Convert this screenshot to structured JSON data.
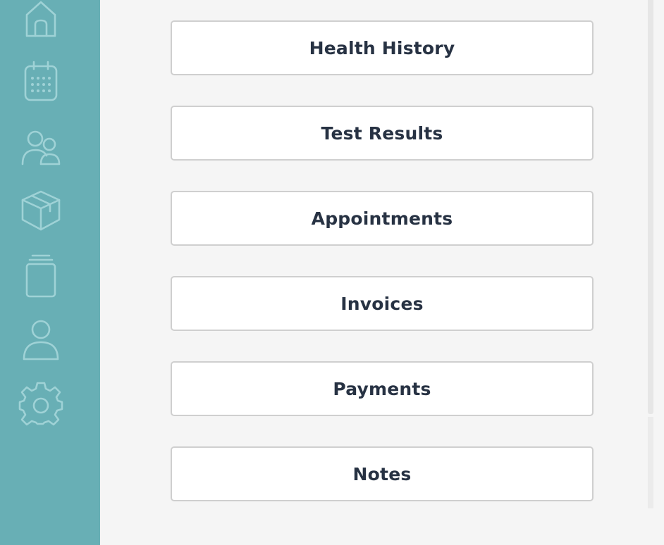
{
  "sidebar": {
    "items": [
      {
        "icon": "home-icon"
      },
      {
        "icon": "calendar-icon"
      },
      {
        "icon": "users-icon"
      },
      {
        "icon": "box-icon"
      },
      {
        "icon": "archive-icon"
      },
      {
        "icon": "user-icon"
      },
      {
        "icon": "gear-icon"
      }
    ]
  },
  "menu": {
    "health_history": "Health History",
    "test_results": "Test Results",
    "appointments": "Appointments",
    "invoices": "Invoices",
    "payments": "Payments",
    "notes": "Notes"
  },
  "colors": {
    "sidebar_bg": "#68afb5",
    "sidebar_icon": "#9fd2d6",
    "page_bg": "#f5f5f5",
    "button_text": "#273243",
    "button_border": "#cfcfcf"
  }
}
